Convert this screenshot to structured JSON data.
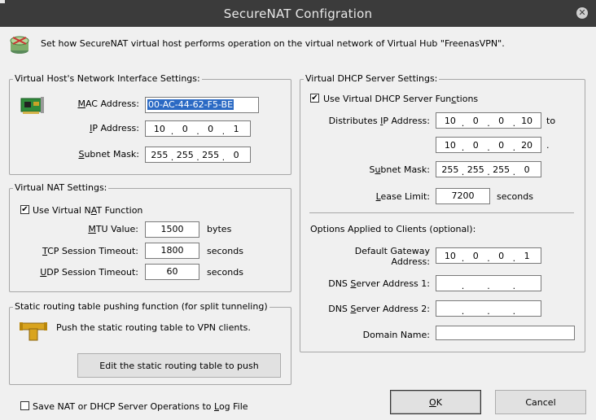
{
  "window": {
    "title": "SecureNAT Configration",
    "close_glyph": "✕"
  },
  "header": {
    "description": "Set how SecureNAT virtual host performs operation on the virtual network of Virtual Hub \"FreenasVPN\"."
  },
  "host_interface": {
    "legend": "Virtual Host's Network Interface Settings:",
    "mac_label": "MAC Address:",
    "mac_value": "00-AC-44-62-F5-BE",
    "ip_label": "IP Address:",
    "ip": [
      "10",
      "0",
      "0",
      "1"
    ],
    "mask_label": "Subnet Mask:",
    "mask": [
      "255",
      "255",
      "255",
      "0"
    ]
  },
  "nat": {
    "legend": "Virtual NAT Settings:",
    "use_label": "Use Virtual NAT Function",
    "use_checked": true,
    "mtu_label": "MTU Value:",
    "mtu_value": "1500",
    "mtu_unit": "bytes",
    "tcp_label": "TCP Session Timeout:",
    "tcp_value": "1800",
    "tcp_unit": "seconds",
    "udp_label": "UDP Session Timeout:",
    "udp_value": "60",
    "udp_unit": "seconds"
  },
  "routing": {
    "legend": "Static routing table pushing function (for split tunneling)",
    "description": "Push the static routing table to VPN clients.",
    "edit_button": "Edit the static routing table to push"
  },
  "log": {
    "label": "Save NAT or DHCP Server Operations to Log File",
    "checked": false
  },
  "dhcp": {
    "legend": "Virtual DHCP Server Settings:",
    "use_label": "Use Virtual DHCP Server Functions",
    "use_checked": true,
    "range_label": "Distributes IP Address:",
    "range_start": [
      "10",
      "0",
      "0",
      "10"
    ],
    "to_label": "to",
    "range_end": [
      "10",
      "0",
      "0",
      "20"
    ],
    "end_suffix": ".",
    "mask_label": "Subnet Mask:",
    "mask": [
      "255",
      "255",
      "255",
      "0"
    ],
    "lease_label": "Lease Limit:",
    "lease_value": "7200",
    "lease_unit": "seconds",
    "options_label": "Options Applied to Clients (optional):",
    "gateway_label_1": "Default Gateway",
    "gateway_label_2": "Address:",
    "gateway": [
      "10",
      "0",
      "0",
      "1"
    ],
    "dns1_label": "DNS Server Address 1:",
    "dns1": [
      "",
      "",
      "",
      ""
    ],
    "dns2_label": "DNS Server Address 2:",
    "dns2": [
      "",
      "",
      "",
      ""
    ],
    "domain_label": "Domain Name:",
    "domain_value": ""
  },
  "buttons": {
    "ok": "OK",
    "cancel": "Cancel"
  }
}
